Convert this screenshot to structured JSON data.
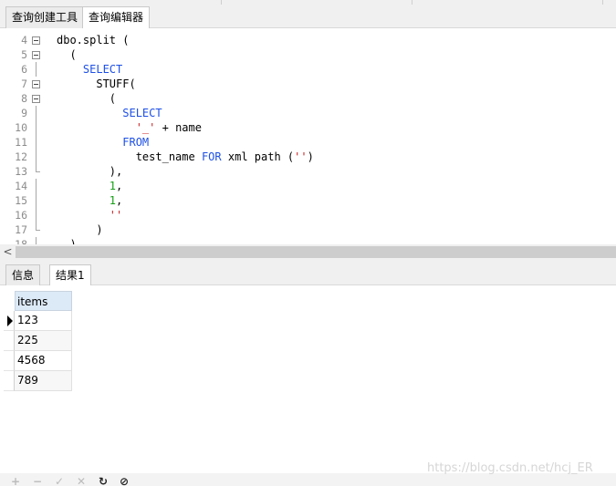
{
  "top_tabs": [
    {
      "label": "查询创建工具",
      "active": false
    },
    {
      "label": "查询编辑器",
      "active": true
    }
  ],
  "code_lines": [
    {
      "num": "4",
      "fold": "box",
      "tokens": [
        {
          "t": "dbo.split (",
          "c": "plain"
        }
      ]
    },
    {
      "num": "5",
      "fold": "box",
      "tokens": [
        {
          "t": "  (",
          "c": "plain"
        }
      ]
    },
    {
      "num": "6",
      "fold": "line",
      "tokens": [
        {
          "t": "    ",
          "c": "plain"
        },
        {
          "t": "SELECT",
          "c": "kw"
        }
      ]
    },
    {
      "num": "7",
      "fold": "box",
      "tokens": [
        {
          "t": "      STUFF(",
          "c": "plain"
        }
      ]
    },
    {
      "num": "8",
      "fold": "box",
      "tokens": [
        {
          "t": "        (",
          "c": "plain"
        }
      ]
    },
    {
      "num": "9",
      "fold": "line",
      "tokens": [
        {
          "t": "          ",
          "c": "plain"
        },
        {
          "t": "SELECT",
          "c": "kw"
        }
      ]
    },
    {
      "num": "10",
      "fold": "line",
      "tokens": [
        {
          "t": "            ",
          "c": "plain"
        },
        {
          "t": "'_'",
          "c": "str"
        },
        {
          "t": " + name",
          "c": "plain"
        }
      ]
    },
    {
      "num": "11",
      "fold": "line",
      "tokens": [
        {
          "t": "          ",
          "c": "plain"
        },
        {
          "t": "FROM",
          "c": "kw"
        }
      ]
    },
    {
      "num": "12",
      "fold": "line",
      "tokens": [
        {
          "t": "            test_name ",
          "c": "plain"
        },
        {
          "t": "FOR",
          "c": "kw"
        },
        {
          "t": " xml path (",
          "c": "plain"
        },
        {
          "t": "''",
          "c": "str"
        },
        {
          "t": ")",
          "c": "plain"
        }
      ]
    },
    {
      "num": "13",
      "fold": "end",
      "tokens": [
        {
          "t": "        ),",
          "c": "plain"
        }
      ]
    },
    {
      "num": "14",
      "fold": "line",
      "tokens": [
        {
          "t": "        ",
          "c": "plain"
        },
        {
          "t": "1",
          "c": "num"
        },
        {
          "t": ",",
          "c": "plain"
        }
      ]
    },
    {
      "num": "15",
      "fold": "line",
      "tokens": [
        {
          "t": "        ",
          "c": "plain"
        },
        {
          "t": "1",
          "c": "num"
        },
        {
          "t": ",",
          "c": "plain"
        }
      ]
    },
    {
      "num": "16",
      "fold": "line",
      "tokens": [
        {
          "t": "        ",
          "c": "plain"
        },
        {
          "t": "''",
          "c": "str"
        }
      ]
    },
    {
      "num": "17",
      "fold": "end",
      "tokens": [
        {
          "t": "      )",
          "c": "plain"
        }
      ]
    },
    {
      "num": "18",
      "fold": "end",
      "tokens": [
        {
          "t": "  )",
          "c": "plain"
        }
      ]
    }
  ],
  "scroll_left_arrow": "<",
  "result_tabs": [
    {
      "label": "信息",
      "active": false
    },
    {
      "label": "结果1",
      "active": true
    }
  ],
  "grid": {
    "column": "items",
    "rows": [
      "123",
      "225",
      "4568",
      "789"
    ],
    "current_row": 0
  },
  "toolbar_icons": [
    {
      "name": "add-record-icon",
      "glyph": "+",
      "enabled": false
    },
    {
      "name": "delete-record-icon",
      "glyph": "−",
      "enabled": false
    },
    {
      "name": "apply-changes-icon",
      "glyph": "✓",
      "enabled": false
    },
    {
      "name": "discard-changes-icon",
      "glyph": "✕",
      "enabled": false
    },
    {
      "name": "refresh-icon",
      "glyph": "↻",
      "enabled": true
    },
    {
      "name": "stop-icon",
      "glyph": "⊘",
      "enabled": true
    }
  ],
  "watermark": "https://blog.csdn.net/hcj_ER",
  "colors": {
    "keyword": "#1e50e6",
    "string": "#c81e1e",
    "number": "#16a016",
    "grid_header": "#dce9f7"
  }
}
